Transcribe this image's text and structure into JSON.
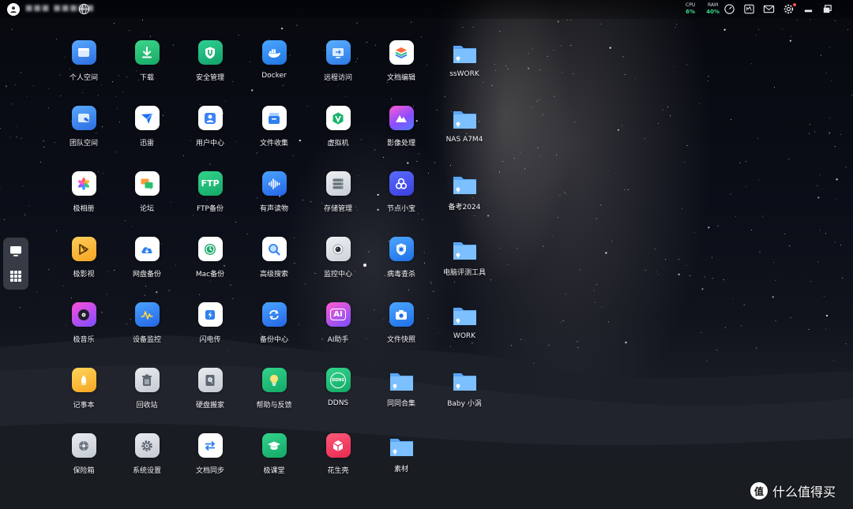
{
  "topbar": {
    "username": "■■■ ■■■■■",
    "meters": [
      {
        "label": "CPU",
        "value": "6%"
      },
      {
        "label": "RAM",
        "value": "40%"
      }
    ],
    "icons": [
      "speedometer-icon",
      "monitor-panel-icon",
      "mail-icon",
      "gear-icon",
      "minimize-icon",
      "restore-icon"
    ]
  },
  "dock": {
    "items": [
      "desktop-icon",
      "app-grid-icon"
    ]
  },
  "apps": [
    [
      "个人空间",
      "下载",
      "安全管理",
      "Docker",
      "远程访问",
      "文档编辑",
      "ssWORK"
    ],
    [
      "团队空间",
      "迅雷",
      "用户中心",
      "文件收集",
      "虚拟机",
      "影像处理",
      "NAS A7M4"
    ],
    [
      "极相册",
      "论坛",
      "FTP备份",
      "有声读物",
      "存储管理",
      "节点小宝",
      "备考2024"
    ],
    [
      "极影视",
      "网盘备份",
      "Mac备份",
      "高级搜索",
      "监控中心",
      "病毒查杀",
      "电脑评测工具"
    ],
    [
      "极音乐",
      "设备监控",
      "闪电传",
      "备份中心",
      "AI助手",
      "文件快照",
      "WORK"
    ],
    [
      "记事本",
      "回收站",
      "硬盘搬家",
      "帮助与反馈",
      "DDNS",
      "同同合集",
      "Baby 小涡"
    ],
    [
      "保险箱",
      "系统设置",
      "文档同步",
      "极课堂",
      "花生壳",
      "素材"
    ]
  ],
  "tile_text": {
    "ftp": "FTP",
    "ai": "AI",
    "ddns": "DDNS"
  },
  "watermark": {
    "text": "什么值得买",
    "logo": "值"
  },
  "colors": {
    "cpu_ok": "#39d98a",
    "folder": "#6fb6ff",
    "notify": "#ff4d4f"
  }
}
